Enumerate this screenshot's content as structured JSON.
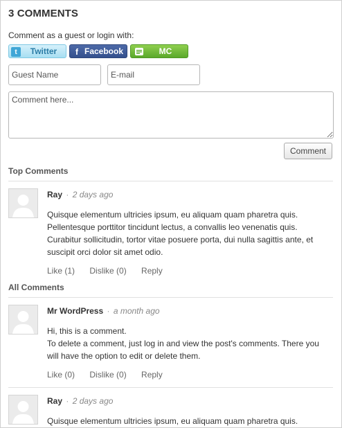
{
  "title": "3 COMMENTS",
  "prompt": "Comment as a guest or login with:",
  "social": {
    "twitter": "Twitter",
    "facebook": "Facebook",
    "mc": "MC",
    "twitter_glyph": "t",
    "facebook_glyph": "f"
  },
  "form": {
    "name_placeholder": "Guest Name",
    "email_placeholder": "E-mail",
    "comment_placeholder": "Comment here...",
    "submit_label": "Comment"
  },
  "sections": {
    "top": "Top Comments",
    "all": "All Comments"
  },
  "top_comments": [
    {
      "author": "Ray",
      "sep": "·",
      "time": "2 days ago",
      "paragraphs": [
        "Quisque elementum ultricies ipsum, eu aliquam quam pharetra quis. Pellentesque porttitor tincidunt lectus, a convallis leo venenatis quis. Curabitur sollicitudin, tortor vitae posuere porta, dui nulla sagittis ante, et suscipit orci dolor sit amet odio."
      ],
      "like": "Like (1)",
      "dislike": "Dislike (0)",
      "reply": "Reply"
    }
  ],
  "all_comments": [
    {
      "author": "Mr WordPress",
      "sep": "·",
      "time": "a month ago",
      "paragraphs": [
        "Hi, this is a comment.",
        "To delete a comment, just log in and view the post's comments. There you will have the option to edit or delete them."
      ],
      "like": "Like (0)",
      "dislike": "Dislike (0)",
      "reply": "Reply"
    },
    {
      "author": "Ray",
      "sep": "·",
      "time": "2 days ago",
      "paragraphs": [
        "Quisque elementum ultricies ipsum, eu aliquam quam pharetra quis."
      ]
    }
  ]
}
